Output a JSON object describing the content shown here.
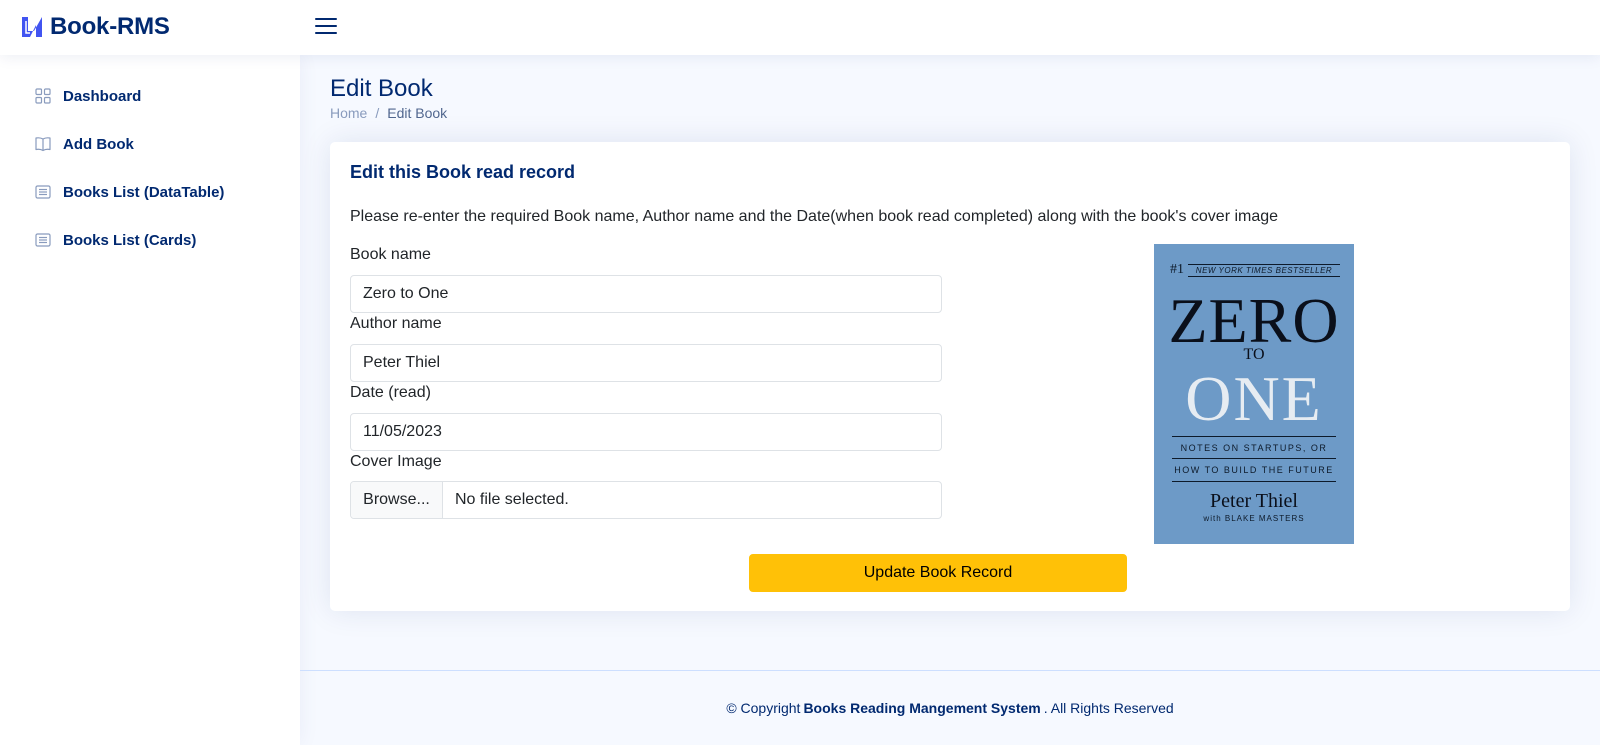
{
  "brand": {
    "name": "Book-RMS",
    "accent": "#4154f1",
    "primary": "#012970"
  },
  "sidebar": {
    "items": [
      {
        "label": "Dashboard",
        "icon": "grid-icon"
      },
      {
        "label": "Add Book",
        "icon": "book-open-icon"
      },
      {
        "label": "Books List (DataTable)",
        "icon": "list-icon"
      },
      {
        "label": "Books List (Cards)",
        "icon": "list-icon"
      }
    ]
  },
  "page": {
    "title": "Edit Book",
    "breadcrumb": {
      "home": "Home",
      "separator": "/",
      "current": "Edit Book"
    }
  },
  "card": {
    "title": "Edit this Book read record",
    "description": "Please re-enter the required Book name, Author name and the Date(when book read completed) along with the book's cover image"
  },
  "form": {
    "book_name": {
      "label": "Book name",
      "value": "Zero to One"
    },
    "author_name": {
      "label": "Author name",
      "value": "Peter Thiel"
    },
    "date_read": {
      "label": "Date (read)",
      "value": "11/05/2023"
    },
    "cover_image": {
      "label": "Cover Image",
      "button": "Browse...",
      "status": "No file selected."
    },
    "submit_label": "Update Book Record",
    "submit_color": "#ffc107"
  },
  "cover": {
    "rank": "#1",
    "banner": "NEW YORK TIMES BESTSELLER",
    "title_top": "ZERO",
    "title_mid": "TO",
    "title_bottom": "ONE",
    "subtitle_1": "NOTES ON STARTUPS, OR",
    "subtitle_2": "HOW TO BUILD THE FUTURE",
    "author": "Peter Thiel",
    "coauthor": "with BLAKE MASTERS",
    "background": "#6d9ac7"
  },
  "footer": {
    "prefix": "© Copyright",
    "name": "Books Reading Mangement System",
    "suffix": ". All Rights Reserved"
  }
}
